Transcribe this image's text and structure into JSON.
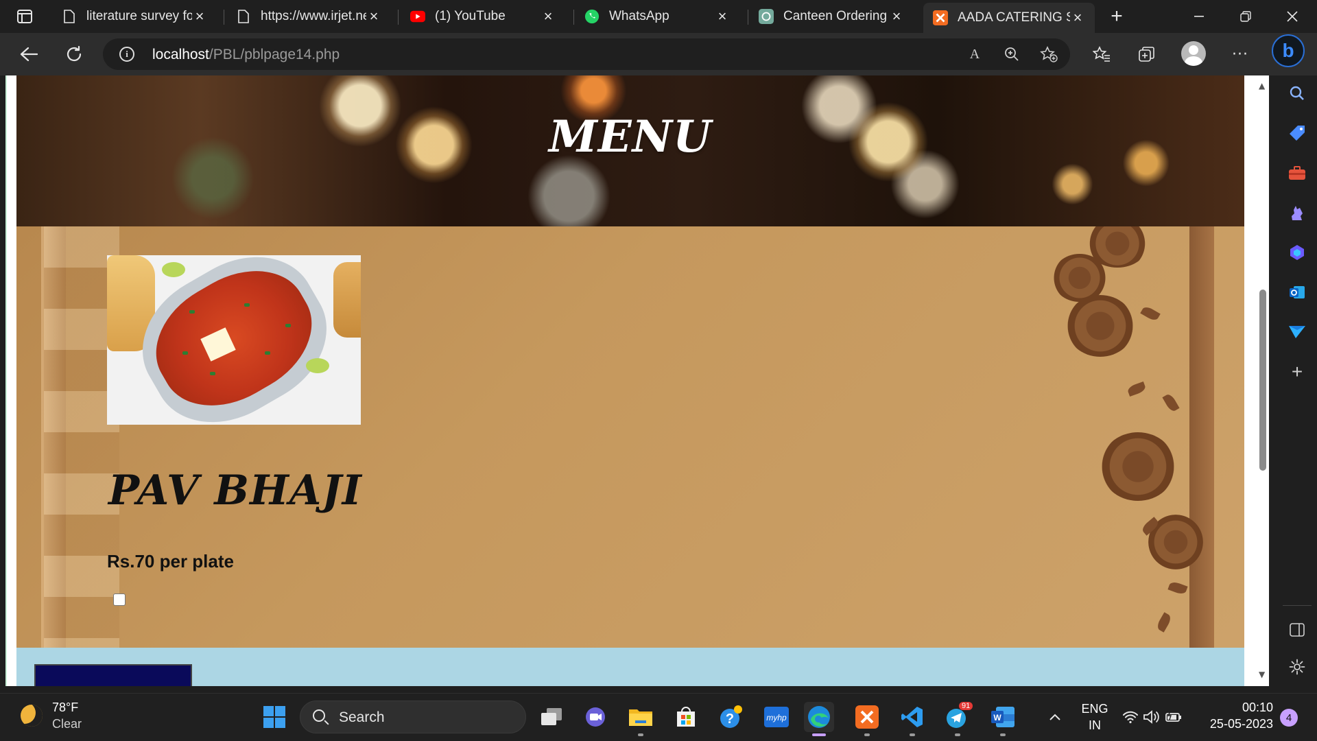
{
  "browser": {
    "tabs": [
      {
        "title": "literature survey for",
        "icon": "page-icon"
      },
      {
        "title": "https://www.irjet.ne",
        "icon": "page-icon"
      },
      {
        "title": "(1) YouTube",
        "icon": "youtube-icon"
      },
      {
        "title": "WhatsApp",
        "icon": "whatsapp-icon"
      },
      {
        "title": "Canteen Ordering S",
        "icon": "chatgpt-icon"
      },
      {
        "title": "AADA CATERING SE",
        "icon": "xampp-icon"
      }
    ],
    "active_tab_index": 5,
    "url_host": "localhost",
    "url_path": "/PBL/pblpage14.php",
    "read_aloud_label": "A"
  },
  "page": {
    "hero_title": "MENU",
    "dish": {
      "name": "PAV BHAJI",
      "price": "Rs.70 per plate",
      "selected": false
    }
  },
  "taskbar": {
    "weather_temp": "78°F",
    "weather_condition": "Clear",
    "search_placeholder": "Search",
    "language_top": "ENG",
    "language_bottom": "IN",
    "time": "00:10",
    "date": "25-05-2023",
    "notification_count": "4",
    "telegram_badge": "91"
  },
  "colors": {
    "hero_text": "#ffffff",
    "menu_background": "#c99a5e",
    "footer_strip": "#acd6e4",
    "dark_button": "#0a0a5a",
    "accent": "#3c8cff"
  }
}
